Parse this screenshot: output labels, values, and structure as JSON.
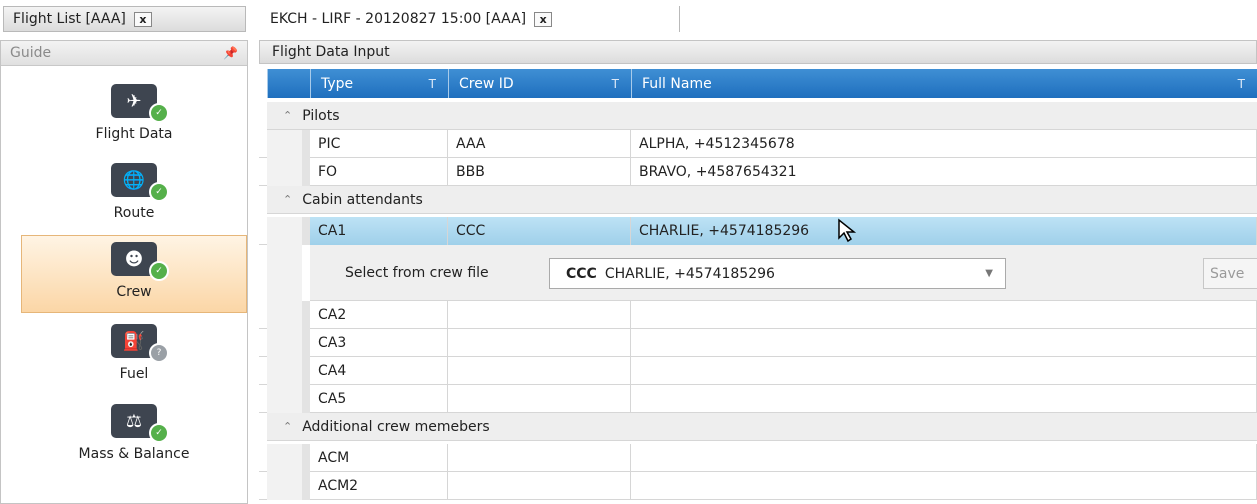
{
  "tabs": [
    {
      "label": "Flight List [AAA]",
      "close": "x"
    },
    {
      "label": "EKCH - LIRF - 20120827 15:00 [AAA]",
      "close": "x"
    }
  ],
  "guide": {
    "title": "Guide",
    "pin_icon": "pin-icon",
    "items": [
      {
        "label": "Flight Data",
        "icon": "plane-icon",
        "status": "complete"
      },
      {
        "label": "Route",
        "icon": "globe-icon",
        "status": "complete"
      },
      {
        "label": "Crew",
        "icon": "crew-icon",
        "status": "complete",
        "selected": true
      },
      {
        "label": "Fuel",
        "icon": "fuel-icon",
        "status": "pending"
      },
      {
        "label": "Mass & Balance",
        "icon": "scale-icon",
        "status": "complete"
      }
    ]
  },
  "panel": {
    "title": "Flight Data Input",
    "columns": [
      {
        "label": "Type",
        "filter": "T"
      },
      {
        "label": "Crew ID",
        "filter": "T"
      },
      {
        "label": "Full Name",
        "filter": "T"
      }
    ],
    "groups": [
      {
        "name": "Pilots",
        "rows": [
          {
            "type": "PIC",
            "crew_id": "AAA",
            "full_name": "ALPHA, +4512345678"
          },
          {
            "type": "FO",
            "crew_id": "BBB",
            "full_name": "BRAVO, +4587654321"
          }
        ]
      },
      {
        "name": "Cabin attendants",
        "rows": [
          {
            "type": "CA1",
            "crew_id": "CCC",
            "full_name": "CHARLIE, +4574185296"
          },
          {
            "type": "CA2",
            "crew_id": "",
            "full_name": ""
          },
          {
            "type": "CA3",
            "crew_id": "",
            "full_name": ""
          },
          {
            "type": "CA4",
            "crew_id": "",
            "full_name": ""
          },
          {
            "type": "CA5",
            "crew_id": "",
            "full_name": ""
          }
        ]
      },
      {
        "name": "Additional crew memebers",
        "rows": [
          {
            "type": "ACM",
            "crew_id": "",
            "full_name": ""
          },
          {
            "type": "ACM2",
            "crew_id": "",
            "full_name": ""
          }
        ]
      }
    ],
    "detail": {
      "label": "Select from crew file",
      "selected_id": "CCC",
      "selected_name": "CHARLIE, +4574185296",
      "save_label": "Save"
    }
  },
  "colors": {
    "header_blue": "#2a7cc7",
    "selected_row": "#acd8ef",
    "guide_selected": "#fbd6a6"
  }
}
